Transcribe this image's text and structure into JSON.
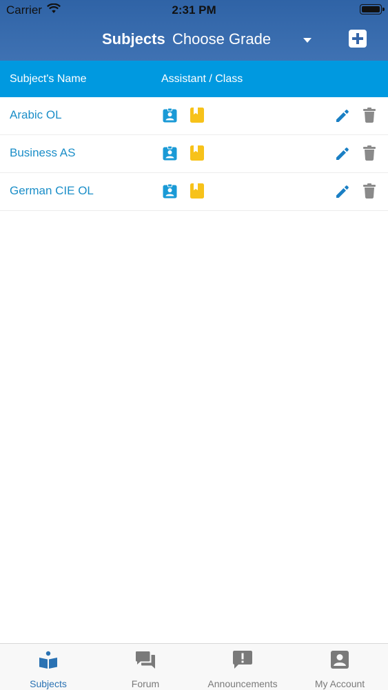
{
  "status_bar": {
    "carrier": "Carrier",
    "time": "2:31 PM"
  },
  "nav": {
    "title": "Subjects",
    "grade_select": "Choose Grade"
  },
  "table_header": {
    "name": "Subject's Name",
    "assistant_class": "Assistant / Class"
  },
  "subjects": [
    {
      "name": "Arabic OL"
    },
    {
      "name": "Business AS"
    },
    {
      "name": "German CIE OL"
    }
  ],
  "tabs": [
    {
      "label": "Subjects",
      "icon": "book-reader-icon",
      "active": true
    },
    {
      "label": "Forum",
      "icon": "chat-bubbles-icon",
      "active": false
    },
    {
      "label": "Announcements",
      "icon": "alert-bubble-icon",
      "active": false
    },
    {
      "label": "My Account",
      "icon": "account-icon",
      "active": false
    }
  ],
  "colors": {
    "nav_bg": "#3565a8",
    "header_bg": "#0099e0",
    "link": "#1b8ec8",
    "assistant_icon": "#1a9ad6",
    "class_icon": "#f7c21a",
    "edit_icon": "#1a7fc4",
    "delete_icon": "#8a8a8a",
    "tab_active": "#2a72b3",
    "tab_inactive": "#7a7a7a"
  }
}
